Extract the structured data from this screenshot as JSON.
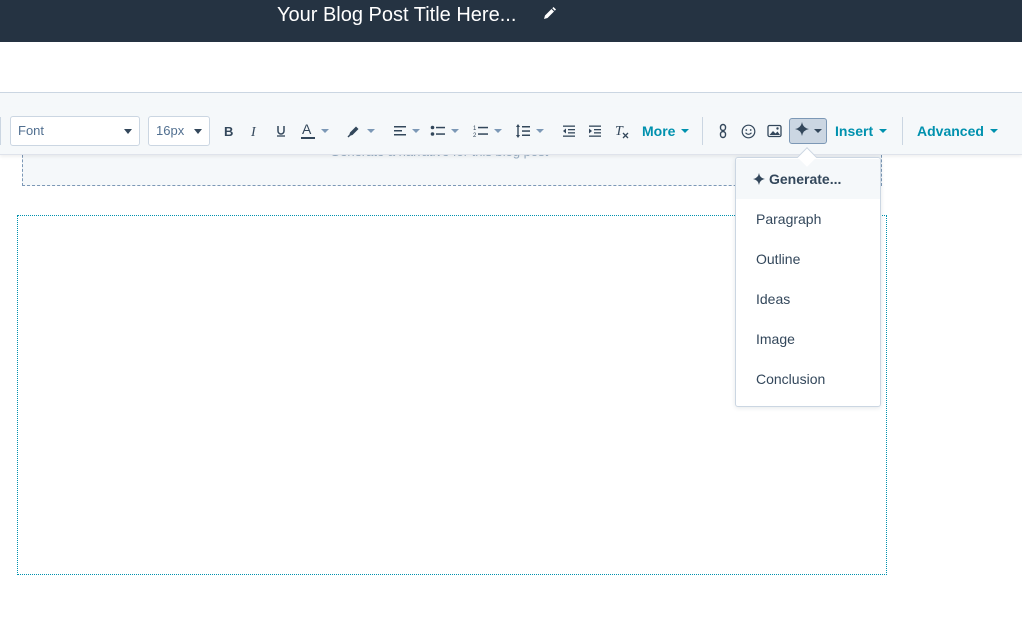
{
  "header": {
    "post_title": "Your Blog Post Title Here...",
    "edit_icon": "pencil-icon"
  },
  "toolbar": {
    "font_select": "Font",
    "size_select": "16px",
    "buttons": [
      {
        "name": "bold",
        "icon": "bold-icon"
      },
      {
        "name": "italic",
        "icon": "italic-icon"
      },
      {
        "name": "underline",
        "icon": "underline-icon"
      },
      {
        "name": "text-color",
        "icon": "text-color-icon"
      },
      {
        "name": "highlight",
        "icon": "highlight-icon"
      },
      {
        "name": "align",
        "icon": "align-left-icon"
      },
      {
        "name": "bullet-list",
        "icon": "bullet-list-icon"
      },
      {
        "name": "numbered-list",
        "icon": "numbered-list-icon"
      },
      {
        "name": "line-height",
        "icon": "line-height-icon"
      },
      {
        "name": "outdent",
        "icon": "outdent-icon"
      },
      {
        "name": "indent",
        "icon": "indent-icon"
      },
      {
        "name": "clear-format",
        "icon": "clear-format-icon"
      },
      {
        "name": "link",
        "icon": "link-icon"
      },
      {
        "name": "emoji",
        "icon": "emoji-icon"
      },
      {
        "name": "image",
        "icon": "image-icon"
      },
      {
        "name": "ai-assistant",
        "icon": "sparkle-icon"
      }
    ],
    "more_label": "More",
    "insert_label": "Insert",
    "advanced_label": "Advanced"
  },
  "editor": {
    "module_placeholder": "Generate a narrative for this blog post"
  },
  "ai_menu": {
    "items": [
      {
        "label": "Generate...",
        "active": true,
        "icon": "sparkle-icon"
      },
      {
        "label": "Paragraph"
      },
      {
        "label": "Outline"
      },
      {
        "label": "Ideas"
      },
      {
        "label": "Image"
      },
      {
        "label": "Conclusion"
      }
    ]
  },
  "colors": {
    "header_bg": "#253342",
    "accent": "#0091ae",
    "text": "#33475b"
  }
}
